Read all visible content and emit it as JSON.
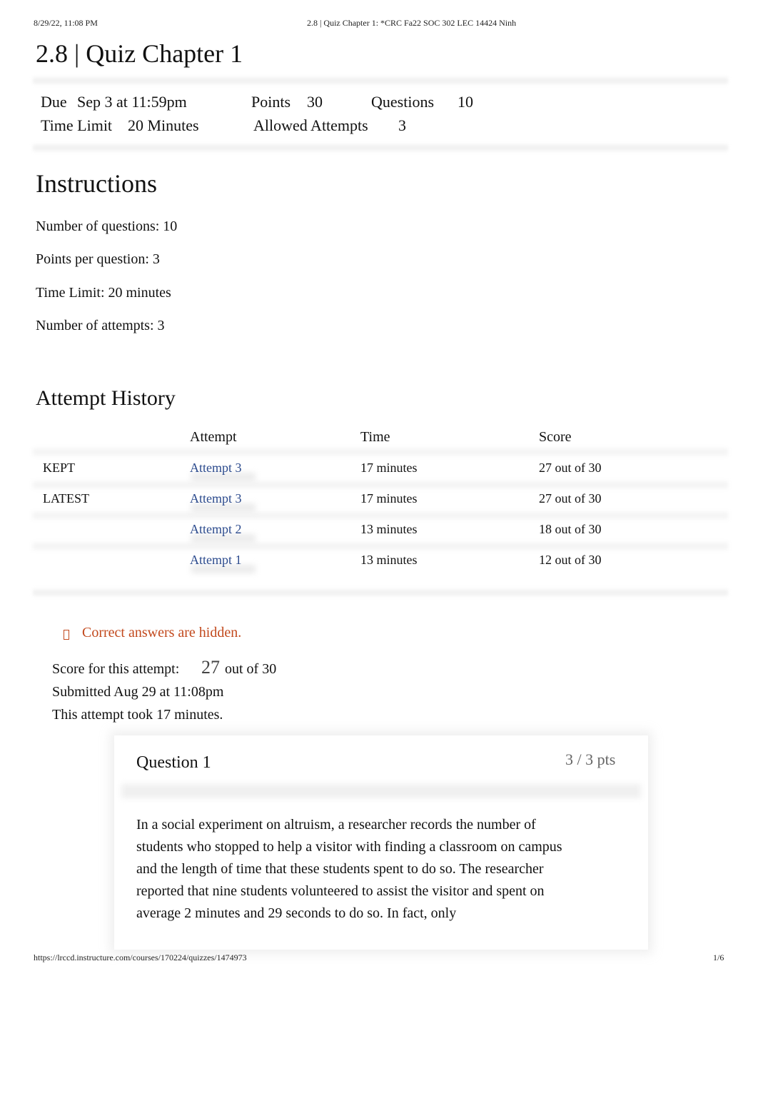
{
  "print_header": {
    "datetime": "8/29/22, 11:08 PM",
    "doc_title": "2.8 | Quiz Chapter 1: *CRC Fa22 SOC 302 LEC 14424 Ninh"
  },
  "page_title": "2.8 | Quiz Chapter 1",
  "quiz_meta": {
    "due_label": "Due",
    "due_value": "Sep 3 at 11:59pm",
    "points_label": "Points",
    "points_value": "30",
    "questions_label": "Questions",
    "questions_value": "10",
    "time_limit_label": "Time Limit",
    "time_limit_value": "20 Minutes",
    "allowed_attempts_label": "Allowed Attempts",
    "allowed_attempts_value": "3"
  },
  "instructions": {
    "heading": "Instructions",
    "lines": [
      "Number of questions: 10",
      "Points per question: 3",
      "Time Limit: 20 minutes",
      "Number of attempts: 3"
    ]
  },
  "attempt_history": {
    "heading": "Attempt History",
    "columns": [
      "",
      "Attempt",
      "Time",
      "Score"
    ],
    "rows": [
      {
        "tag": "KEPT",
        "attempt": "Attempt 3",
        "time": "17 minutes",
        "score": "27 out of 30"
      },
      {
        "tag": "LATEST",
        "attempt": "Attempt 3",
        "time": "17 minutes",
        "score": "27 out of 30"
      },
      {
        "tag": "",
        "attempt": "Attempt 2",
        "time": "13 minutes",
        "score": "18 out of 30"
      },
      {
        "tag": "",
        "attempt": "Attempt 1",
        "time": "13 minutes",
        "score": "12 out of 30"
      }
    ]
  },
  "notice": {
    "icon": "warning-icon",
    "text": "Correct answers are hidden.",
    "color": "#c2491d"
  },
  "attempt_summary": {
    "score_label": "Score for this attempt:",
    "score_value": "27",
    "score_total": "out of 30",
    "submitted": "Submitted Aug 29 at 11:08pm",
    "duration": "This attempt took 17 minutes."
  },
  "question": {
    "title": "Question 1",
    "points": "3 / 3 pts",
    "text": "In a social experiment on altruism, a researcher records the number of students who stopped to help a visitor with finding a classroom on campus and the length of time that these students spent to do so. The researcher reported that nine students volunteered to assist the visitor and spent on average 2 minutes and 29 seconds to do so. In fact, only"
  },
  "footer": {
    "url": "https://lrccd.instructure.com/courses/170224/quizzes/1474973",
    "page": "1/6"
  },
  "colors": {
    "link": "#2b4a8d",
    "notice": "#c2491d",
    "points_muted": "#666666"
  }
}
